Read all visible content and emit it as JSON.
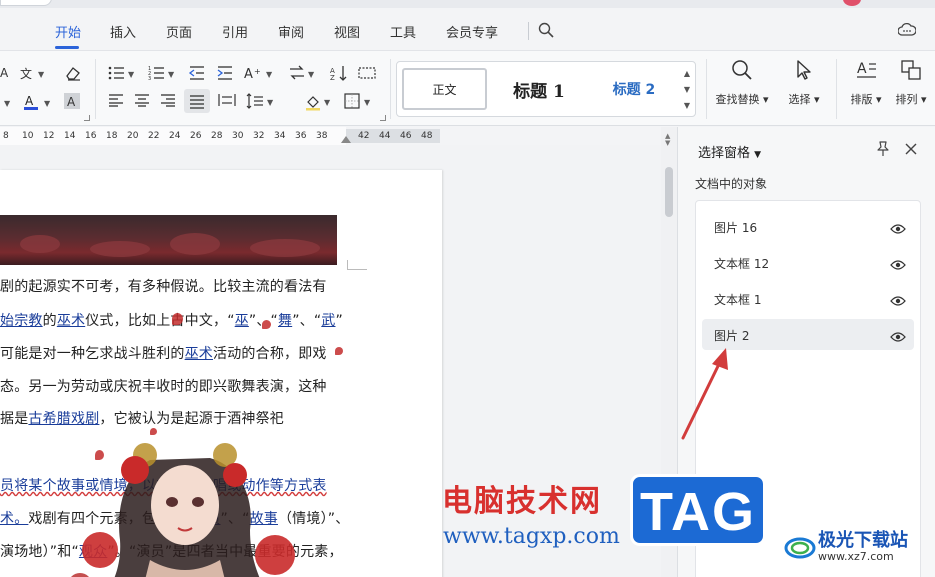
{
  "menu": {
    "items": [
      "开始",
      "插入",
      "页面",
      "引用",
      "审阅",
      "视图",
      "工具",
      "会员专享"
    ],
    "active": "开始"
  },
  "ribbon": {
    "styles": {
      "normal": "正文",
      "heading1": "标题 1",
      "heading2": "标题 2"
    },
    "find_replace": "查找替换",
    "select": "选择",
    "layout": "排版",
    "arrange": "排列"
  },
  "ruler": {
    "labels": [
      "8",
      "10",
      "12",
      "14",
      "16",
      "18",
      "20",
      "22",
      "24",
      "26",
      "28",
      "30",
      "32",
      "34",
      "36",
      "38",
      "42",
      "44",
      "46",
      "48"
    ]
  },
  "document": {
    "lines": [
      [
        {
          "t": "剧的起源实不可考，有多种假说。比较主流的看法有"
        }
      ],
      [
        {
          "t": "始宗教",
          "link": true
        },
        {
          "t": "的"
        },
        {
          "t": "巫术",
          "link": true
        },
        {
          "t": "仪式，比如上古中文，“"
        },
        {
          "t": "巫",
          "link": true
        },
        {
          "t": "”、“"
        },
        {
          "t": "舞",
          "link": true
        },
        {
          "t": "”、“"
        },
        {
          "t": "武",
          "link": true
        },
        {
          "t": "”"
        }
      ],
      [
        {
          "t": "可能是对一种乞求战斗胜利的"
        },
        {
          "t": "巫术",
          "link": true
        },
        {
          "t": "活动的合称，即戏"
        }
      ],
      [
        {
          "t": "态。另一为劳动或庆祝丰收时的即兴歌舞表演，这种"
        }
      ],
      [
        {
          "t": "据是"
        },
        {
          "t": "古希腊戏剧",
          "link": true
        },
        {
          "t": "，它被认为是起源于酒神祭祀"
        }
      ],
      [
        {
          "t": "员将某个故事或情境，以对话、歌唱或动作等方式表",
          "wavy": true
        }
      ],
      [
        {
          "t": "术。",
          "link": true
        },
        {
          "t": "戏剧有四个元素，包括了“"
        },
        {
          "t": "演员",
          "link": true
        },
        {
          "t": "”、“"
        },
        {
          "t": "故事",
          "link": true
        },
        {
          "t": "（情境）”、"
        }
      ],
      [
        {
          "t": "演场地）”和“"
        },
        {
          "t": "观众",
          "link": true
        },
        {
          "t": "”。“演员”是四者当中最重要的元素，"
        }
      ]
    ]
  },
  "selection_pane": {
    "title": "选择窗格",
    "subtitle": "文档中的对象",
    "objects": [
      {
        "label": "图片 16",
        "selected": false
      },
      {
        "label": "文本框 12",
        "selected": false
      },
      {
        "label": "文本框 1",
        "selected": false
      },
      {
        "label": "图片 2",
        "selected": true
      }
    ]
  },
  "watermark": {
    "cn": "电脑技术网",
    "url": "www.tagxp.com",
    "tag": "TAG",
    "site_cn": "极光下载站",
    "site_url": "www.xz7.com"
  },
  "colors": {
    "accent": "#2b63d9",
    "heading2": "#2b6cc2",
    "link": "#1a3d9a",
    "arrow": "#d23c3c",
    "tag_bg": "#1c6ad4"
  }
}
